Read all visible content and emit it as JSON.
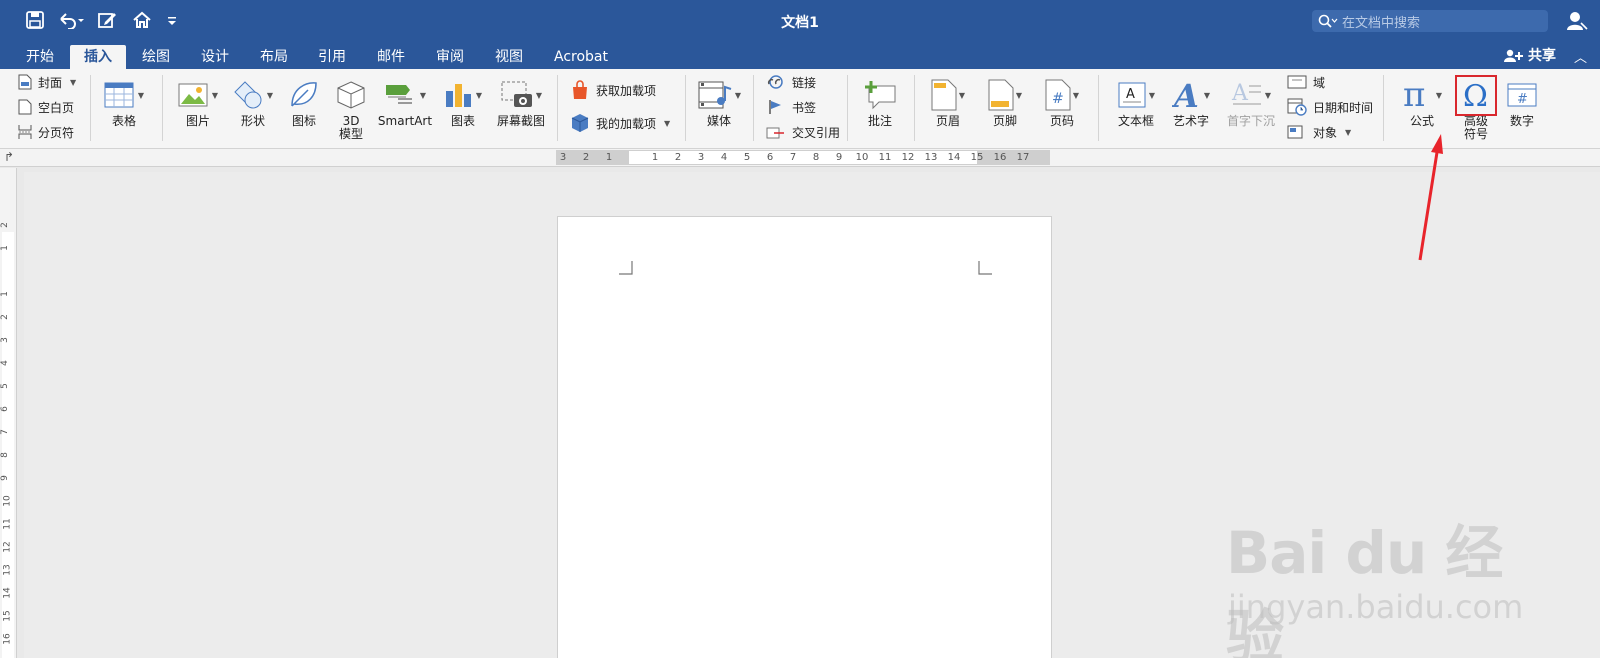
{
  "window": {
    "title": "文档1"
  },
  "search": {
    "placeholder": "在文档中搜索"
  },
  "tabs": [
    {
      "label": "开始"
    },
    {
      "label": "插入"
    },
    {
      "label": "绘图"
    },
    {
      "label": "设计"
    },
    {
      "label": "布局"
    },
    {
      "label": "引用"
    },
    {
      "label": "邮件"
    },
    {
      "label": "审阅"
    },
    {
      "label": "视图"
    },
    {
      "label": "Acrobat"
    }
  ],
  "active_tab": "插入",
  "share": {
    "label": "共享"
  },
  "ribbon": {
    "pages": {
      "cover": "封面",
      "blank": "空白页",
      "break": "分页符"
    },
    "table": "表格",
    "illustrations": {
      "picture": "图片",
      "shapes": "形状",
      "icons": "图标",
      "model3d_1": "3D",
      "model3d_2": "模型",
      "smartart": "SmartArt",
      "chart": "图表",
      "screenshot": "屏幕截图"
    },
    "addins": {
      "get": "获取加载项",
      "mine": "我的加载项"
    },
    "media": "媒体",
    "links": {
      "link": "链接",
      "bookmark": "书签",
      "crossref": "交叉引用"
    },
    "comment": "批注",
    "header_footer": {
      "header": "页眉",
      "footer": "页脚",
      "page_number": "页码"
    },
    "text": {
      "textbox": "文本框",
      "wordart": "艺术字",
      "dropcap": "首字下沉",
      "field": "域",
      "datetime": "日期和时间",
      "object": "对象"
    },
    "symbols": {
      "equation": "公式",
      "advanced_1": "高级",
      "advanced_2": "符号",
      "number": "数字"
    }
  },
  "ruler": {
    "h_labels": [
      "3",
      "2",
      "1",
      "",
      "1",
      "2",
      "3",
      "4",
      "5",
      "6",
      "7",
      "8",
      "9",
      "10",
      "11",
      "12",
      "13",
      "14",
      "15",
      "16",
      "17"
    ],
    "v_labels": [
      "2",
      "1",
      "",
      "1",
      "2",
      "3",
      "4",
      "5",
      "6",
      "7",
      "8",
      "9",
      "10",
      "11",
      "12",
      "13",
      "14",
      "15",
      "16"
    ]
  },
  "watermark": {
    "main": "Bai du 经验",
    "sub": "jingyan.baidu.com"
  },
  "colors": {
    "accent": "#2b579a",
    "highlight": "#d9272d"
  }
}
